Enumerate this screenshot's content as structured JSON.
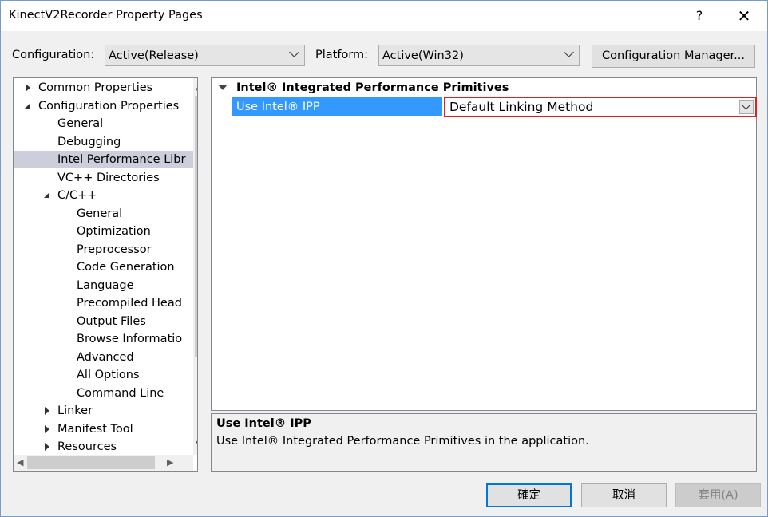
{
  "window": {
    "title": "KinectV2Recorder Property Pages",
    "help_label": "?",
    "close_label": "✕"
  },
  "toolbar": {
    "configuration_label": "Configuration:",
    "configuration_value": "Active(Release)",
    "platform_label": "Platform:",
    "platform_value": "Active(Win32)",
    "config_manager_label": "Configuration Manager..."
  },
  "tree": {
    "items": [
      {
        "label": "Common Properties",
        "state": "collapsed"
      },
      {
        "label": "Configuration Properties",
        "state": "expanded"
      },
      {
        "label": "General"
      },
      {
        "label": "Debugging"
      },
      {
        "label": "Intel Performance Libr",
        "selected": true
      },
      {
        "label": "VC++ Directories"
      },
      {
        "label": "C/C++",
        "state": "expanded"
      },
      {
        "label": "General"
      },
      {
        "label": "Optimization"
      },
      {
        "label": "Preprocessor"
      },
      {
        "label": "Code Generation"
      },
      {
        "label": "Language"
      },
      {
        "label": "Precompiled Head"
      },
      {
        "label": "Output Files"
      },
      {
        "label": "Browse Informatio"
      },
      {
        "label": "Advanced"
      },
      {
        "label": "All Options"
      },
      {
        "label": "Command Line"
      },
      {
        "label": "Linker",
        "state": "collapsed"
      },
      {
        "label": "Manifest Tool",
        "state": "collapsed"
      },
      {
        "label": "Resources",
        "state": "collapsed"
      }
    ]
  },
  "grid": {
    "category": "Intel® Integrated Performance Primitives",
    "property_name": "Use Intel® IPP",
    "property_value": "Default Linking Method"
  },
  "description": {
    "title": "Use Intel® IPP",
    "text": "Use Intel® Integrated Performance Primitives in the application."
  },
  "buttons": {
    "ok": "確定",
    "cancel": "取消",
    "apply": "套用(A)"
  },
  "colors": {
    "selection": "#3399ff",
    "highlight_border": "#e02020",
    "tree_selected": "#cccedb"
  }
}
